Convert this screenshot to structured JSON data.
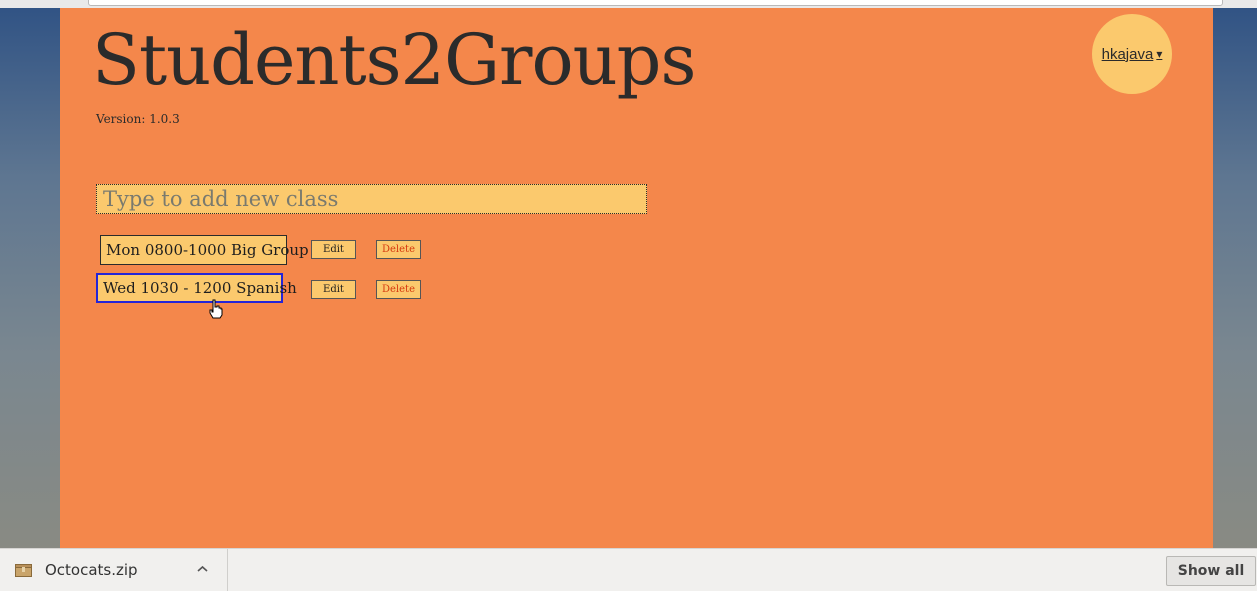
{
  "app": {
    "title": "Students2Groups",
    "version": "Version: 1.0.3"
  },
  "user_menu": {
    "username": "hkajava",
    "caret": "▾"
  },
  "new_class": {
    "placeholder": "Type to add new class",
    "value": ""
  },
  "classes": [
    {
      "name": "Mon 0800-1000 Big Group",
      "edit_label": "Edit",
      "delete_label": "Delete",
      "focused": false
    },
    {
      "name": "Wed 1030 - 1200 Spanish",
      "edit_label": "Edit",
      "delete_label": "Delete",
      "focused": true
    }
  ],
  "downloads": {
    "items": [
      {
        "filename": "Octocats.zip",
        "icon": "zip-file-icon"
      }
    ],
    "show_all_label": "Show all"
  },
  "colors": {
    "page_bg": "#f4874b",
    "field_bg": "#fbc96d",
    "delete_text": "#d63a10",
    "focus_border": "#2424d8"
  }
}
